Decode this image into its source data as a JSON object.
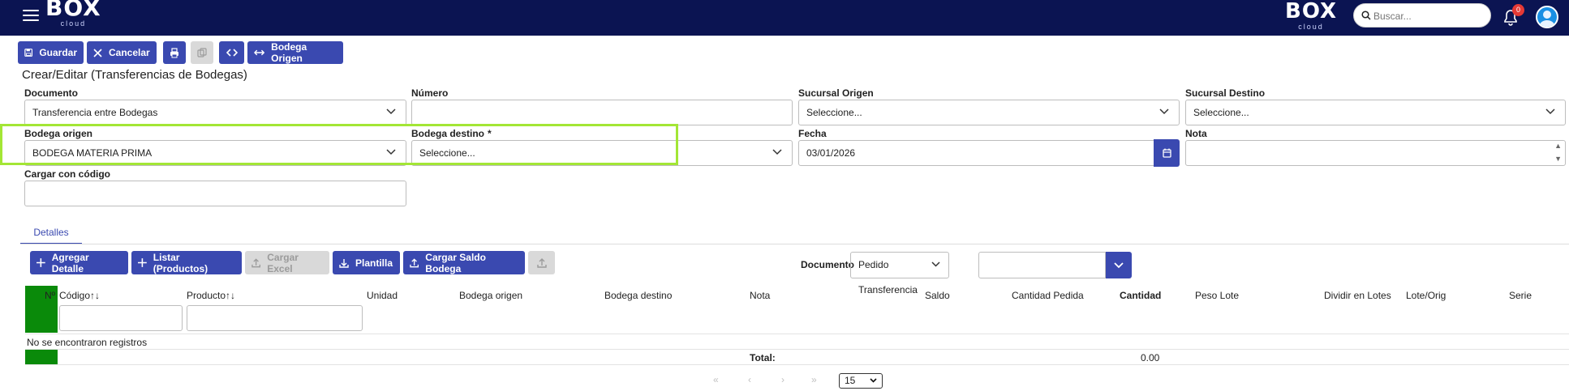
{
  "header": {
    "logo_text": "BOX",
    "logo_sub": "cloud",
    "search_placeholder": "Buscar...",
    "notification_count": "0"
  },
  "toolbar": {
    "save_label": "Guardar",
    "cancel_label": "Cancelar",
    "origin_label": "Bodega Origen"
  },
  "page": {
    "title": "Crear/Editar (Transferencias de Bodegas)"
  },
  "form": {
    "documento": {
      "label": "Documento",
      "value": "Transferencia entre Bodegas"
    },
    "numero": {
      "label": "Número",
      "value": ""
    },
    "sucursal_origen": {
      "label": "Sucursal Origen",
      "value": "Seleccione..."
    },
    "sucursal_destino": {
      "label": "Sucursal Destino",
      "value": "Seleccione..."
    },
    "bodega_origen": {
      "label": "Bodega origen",
      "value": "BODEGA MATERIA PRIMA"
    },
    "bodega_destino": {
      "label": "Bodega destino",
      "required_mark": "*",
      "value": "Seleccione..."
    },
    "fecha": {
      "label": "Fecha",
      "value": "03/01/2026"
    },
    "nota": {
      "label": "Nota",
      "value": ""
    },
    "cargar_codigo": {
      "label": "Cargar con código",
      "value": ""
    }
  },
  "tabs": [
    {
      "label": "Detalles",
      "active": true
    }
  ],
  "actions": {
    "agregar_detalle": "Agregar Detalle",
    "listar_productos": "Listar (Productos)",
    "cargar_excel": "Cargar Excel",
    "plantilla": "Plantilla",
    "cargar_saldo": "Cargar Saldo Bodega"
  },
  "doc_filter": {
    "label": "Documento",
    "value": "Pedido Transferencia"
  },
  "table": {
    "columns": [
      "Nº",
      "Código",
      "Producto",
      "Unidad",
      "Bodega origen",
      "Bodega destino",
      "Nota",
      "Saldo",
      "Cantidad Pedida",
      "Cantidad",
      "Peso Lote",
      "Dividir en Lotes",
      "Lote/Orig",
      "Serie"
    ],
    "empty_message": "No se encontraron registros",
    "total_label": "Total:",
    "total_value": "0.00"
  },
  "pagination": {
    "first": "«",
    "prev": "‹",
    "next": "›",
    "last": "»",
    "page_size": "15"
  },
  "colors": {
    "header_bg": "#0b1452",
    "primary": "#3a49b0",
    "highlight": "#a3e635",
    "row_marker": "#0a8a0a"
  }
}
